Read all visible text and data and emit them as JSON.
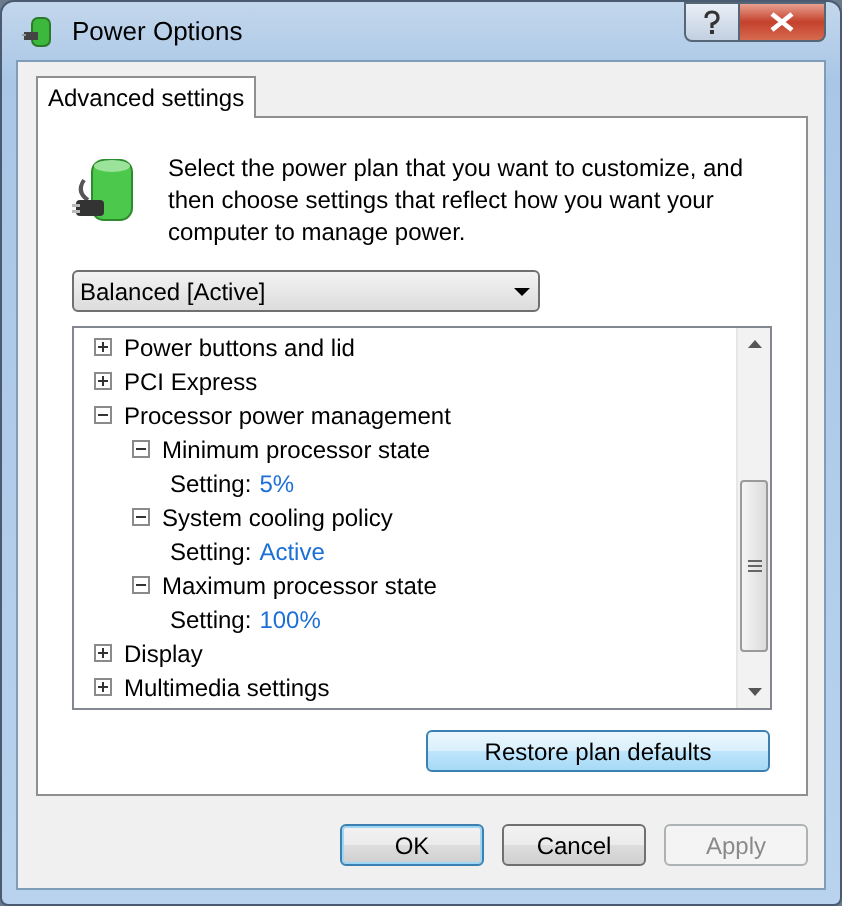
{
  "window": {
    "title": "Power Options"
  },
  "tabs": [
    {
      "label": "Advanced settings",
      "selected": true
    }
  ],
  "description": "Select the power plan that you want to customize, and then choose settings that reflect how you want your computer to manage power.",
  "plan_dropdown": {
    "value": "Balanced [Active]"
  },
  "tree": [
    {
      "kind": "group",
      "label": "Power buttons and lid",
      "expanded": false
    },
    {
      "kind": "group",
      "label": "PCI Express",
      "expanded": false
    },
    {
      "kind": "group",
      "label": "Processor power management",
      "expanded": true,
      "children": [
        {
          "kind": "group",
          "label": "Minimum processor state",
          "expanded": true,
          "children": [
            {
              "kind": "setting",
              "label": "Setting:",
              "value": "5%"
            }
          ]
        },
        {
          "kind": "group",
          "label": "System cooling policy",
          "expanded": true,
          "children": [
            {
              "kind": "setting",
              "label": "Setting:",
              "value": "Active"
            }
          ]
        },
        {
          "kind": "group",
          "label": "Maximum processor state",
          "expanded": true,
          "children": [
            {
              "kind": "setting",
              "label": "Setting:",
              "value": "100%"
            }
          ]
        }
      ]
    },
    {
      "kind": "group",
      "label": "Display",
      "expanded": false
    },
    {
      "kind": "group",
      "label": "Multimedia settings",
      "expanded": false
    }
  ],
  "restore_button": {
    "label": "Restore plan defaults"
  },
  "buttons": [
    {
      "label": "OK",
      "disabled": false,
      "default": true
    },
    {
      "label": "Cancel",
      "disabled": false,
      "default": false
    },
    {
      "label": "Apply",
      "disabled": true,
      "default": false
    }
  ]
}
